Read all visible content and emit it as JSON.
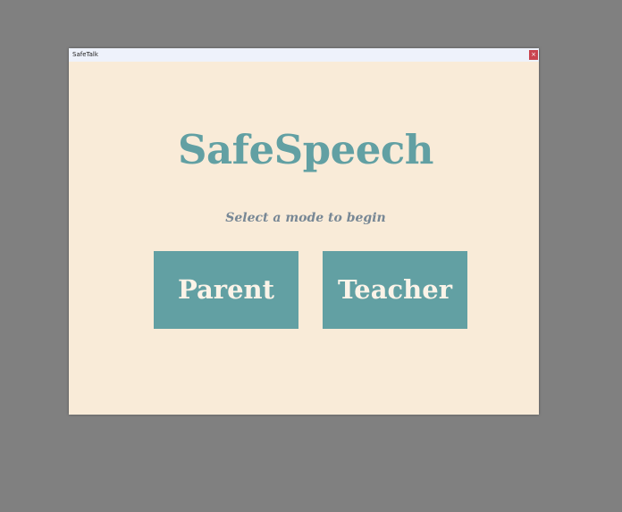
{
  "window": {
    "title": "SafeTalk",
    "close_label": "×"
  },
  "main": {
    "app_title": "SafeSpeech",
    "subtitle": "Select a mode to begin",
    "buttons": {
      "parent_label": "Parent",
      "teacher_label": "Teacher"
    }
  },
  "colors": {
    "desktop": "#808080",
    "window_bg": "#f9ebd8",
    "titlebar_bg": "#eef2fb",
    "accent_teal": "#62a0a3",
    "subtitle_gray": "#778795",
    "close_red": "#c9444f",
    "button_text": "#fbf3e8"
  }
}
